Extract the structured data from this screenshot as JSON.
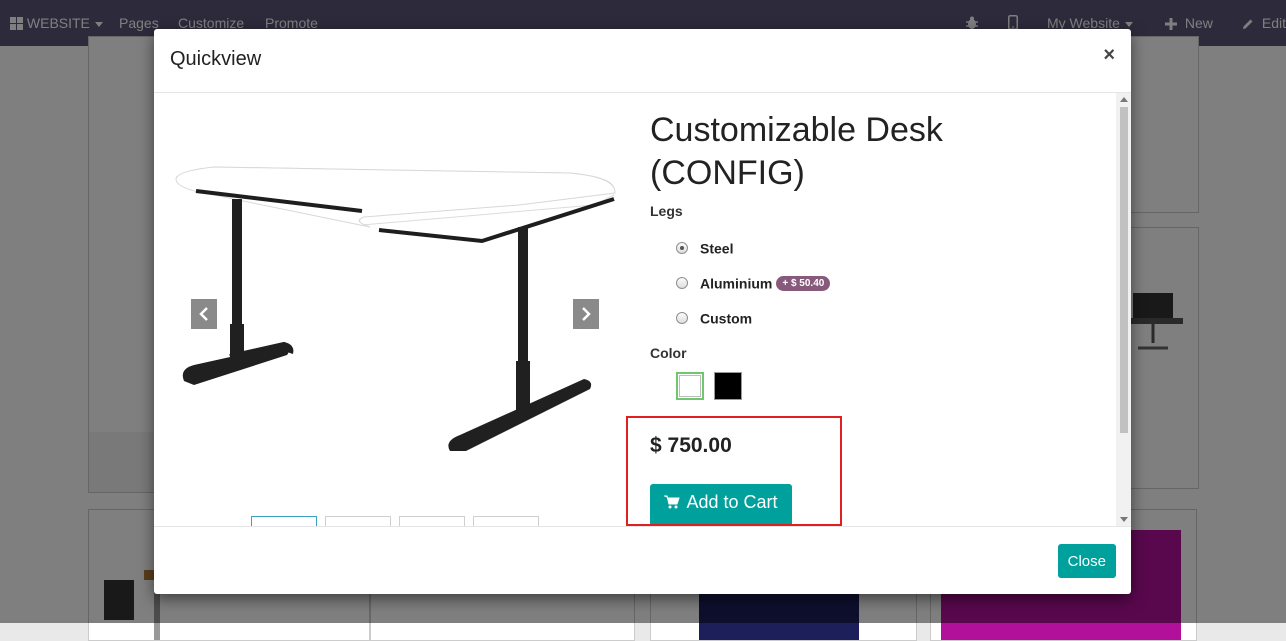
{
  "navbar": {
    "website_label": "WEBSITE",
    "pages_label": "Pages",
    "customize_label": "Customize",
    "promote_label": "Promote",
    "my_website_label": "My Website",
    "new_label": "New",
    "edit_label": "Edit"
  },
  "modal": {
    "title": "Quickview",
    "close_symbol": "×",
    "footer_close_label": "Close"
  },
  "product": {
    "name": "Customizable Desk (CONFIG)",
    "legs_label": "Legs",
    "legs_options": [
      {
        "label": "Steel",
        "checked": true
      },
      {
        "label": "Aluminium",
        "checked": false,
        "extra": "+ $ 50.40"
      },
      {
        "label": "Custom",
        "checked": false
      }
    ],
    "color_label": "Color",
    "colors": [
      "#ffffff",
      "#000000"
    ],
    "selected_color": "#ffffff",
    "price": "$ 750.00",
    "add_to_cart_label": "Add to Cart"
  },
  "carousel": {
    "prev_icon": "chevron-left-icon",
    "next_icon": "chevron-right-icon",
    "thumbnail_count": 4,
    "active_thumbnail": 1
  },
  "colors": {
    "navbar": "#5a5577",
    "accent": "#00a09d",
    "badge": "#875a7b",
    "highlight": "#e02020"
  }
}
